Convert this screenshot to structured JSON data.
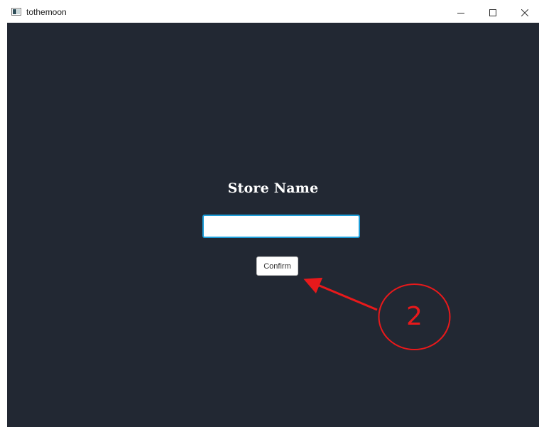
{
  "window": {
    "title": "tothemoon",
    "controls": {
      "minimize": "minimize",
      "maximize": "maximize",
      "close": "close"
    }
  },
  "form": {
    "heading": "Store Name",
    "input_value": "",
    "confirm_label": "Confirm"
  },
  "annotation": {
    "number": "2",
    "color": "#e8191b"
  },
  "colors": {
    "background": "#222833",
    "input_border": "#1e9ed9"
  }
}
